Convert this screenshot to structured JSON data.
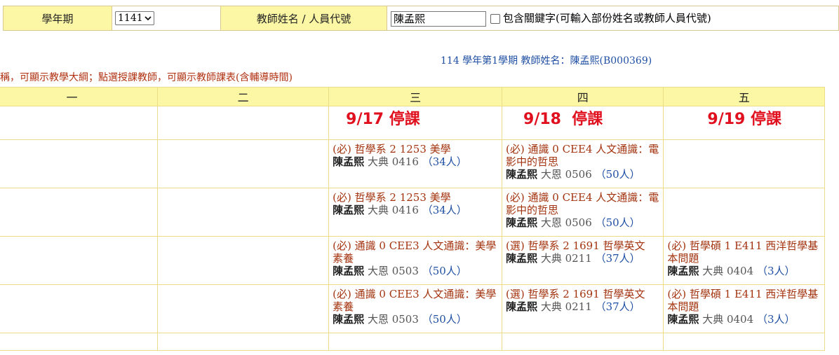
{
  "search": {
    "term_label": "學年期",
    "term_value": "1141",
    "teacher_label": "教師姓名 / 人員代號",
    "teacher_value": "陳孟熙",
    "keyword_label": "包含關鍵字(可輸入部份姓名或教師人員代號)"
  },
  "info_line": "114 學年第1學期 教師姓名：陳孟熙(B000369)",
  "notice": "稱，可顯示教學大綱；點選授課教師，可顯示教師課表(含輔導時間)",
  "days": [
    "一",
    "二",
    "三",
    "四",
    "五"
  ],
  "cancel_notes": {
    "wed": "9/17 停課",
    "thu": "9/18  停課",
    "fri": "9/19 停課"
  },
  "courses": {
    "r1_wed": {
      "title": "(必) 哲學系 2 1253 美學",
      "teacher": "陳孟熙",
      "room": "大典 0416",
      "count": "（34人）"
    },
    "r1_thu": {
      "title": "(必) 通識 0 CEE4 人文通識：電影中的哲思",
      "teacher": "陳孟熙",
      "room": "大恩 0506",
      "count": "（50人）"
    },
    "r2_wed": {
      "title": "(必) 哲學系 2 1253 美學",
      "teacher": "陳孟熙",
      "room": "大典 0416",
      "count": "（34人）"
    },
    "r2_thu": {
      "title": "(必) 通識 0 CEE4 人文通識：電影中的哲思",
      "teacher": "陳孟熙",
      "room": "大恩 0506",
      "count": "（50人）"
    },
    "r3_wed": {
      "title": "(必) 通識 0 CEE3 人文通識：美學素養",
      "teacher": "陳孟熙",
      "room": "大恩 0503",
      "count": "（50人）"
    },
    "r3_thu": {
      "title": "(選) 哲學系 2 1691 哲學英文",
      "teacher": "陳孟熙",
      "room": "大典 0211",
      "count": "（37人）"
    },
    "r3_fri": {
      "title": "(必) 哲學碩 1 E411 西洋哲學基本問題",
      "teacher": "陳孟熙",
      "room": "大典 0404",
      "count": "（3人）"
    },
    "r4_wed": {
      "title": "(必) 通識 0 CEE3 人文通識：美學素養",
      "teacher": "陳孟熙",
      "room": "大恩 0503",
      "count": "（50人）"
    },
    "r4_thu": {
      "title": "(選) 哲學系 2 1691 哲學英文",
      "teacher": "陳孟熙",
      "room": "大典 0211",
      "count": "（37人）"
    },
    "r4_fri": {
      "title": "(必) 哲學碩 1 E411 西洋哲學基本問題",
      "teacher": "陳孟熙",
      "room": "大典 0404",
      "count": "（3人）"
    }
  }
}
